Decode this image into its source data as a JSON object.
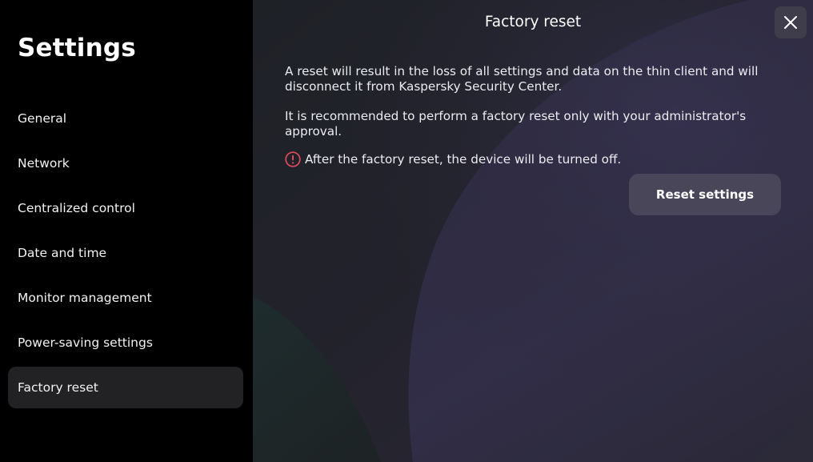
{
  "sidebar": {
    "title": "Settings",
    "items": [
      {
        "label": "General",
        "active": false
      },
      {
        "label": "Network",
        "active": false
      },
      {
        "label": "Centralized control",
        "active": false
      },
      {
        "label": "Date and time",
        "active": false
      },
      {
        "label": "Monitor management",
        "active": false
      },
      {
        "label": "Power-saving settings",
        "active": false
      },
      {
        "label": "Factory reset",
        "active": true
      }
    ]
  },
  "main": {
    "title": "Factory reset",
    "paragraph_1": "A reset will result in the loss of all settings and data on the thin client and will disconnect it from Kaspersky Security Center.",
    "paragraph_2": "It is recommended to perform a factory reset only with your administrator's approval.",
    "warning_text": "After the factory reset, the device will be turned off.",
    "warning_icon": "alert-circle-icon",
    "reset_button_label": "Reset settings",
    "close_icon": "close-icon"
  },
  "colors": {
    "sidebar_bg": "#000000",
    "active_item_bg": "#222224",
    "main_bg": "#1b1d22",
    "accent_purple": "#4a465a",
    "warning_red": "#e04a5a"
  }
}
